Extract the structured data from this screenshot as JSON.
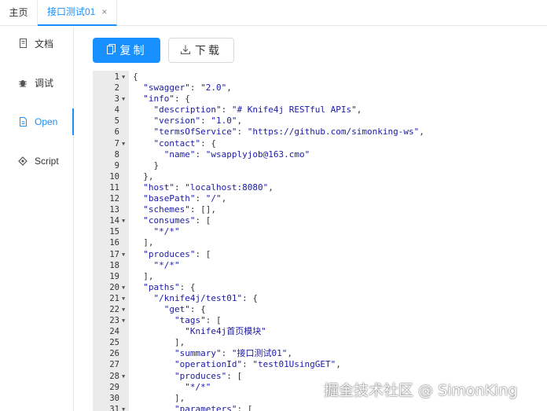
{
  "tabs": [
    {
      "label": "主页",
      "active": false
    },
    {
      "label": "接口测试01",
      "active": true,
      "closable": true
    }
  ],
  "close_icon": "×",
  "menu": [
    {
      "label": "文档",
      "icon": "document-icon",
      "active": false
    },
    {
      "label": "调试",
      "icon": "bug-icon",
      "active": false
    },
    {
      "label": "Open",
      "icon": "file-icon",
      "active": true
    },
    {
      "label": "Script",
      "icon": "code-icon",
      "active": false
    }
  ],
  "buttons": {
    "copy_label": "复制",
    "copy_icon": "copy-icon",
    "download_label": "下载",
    "download_icon": "download-icon"
  },
  "code_lines": [
    {
      "n": "1",
      "fold": true,
      "text": "{"
    },
    {
      "n": "2",
      "fold": false,
      "text": "  \"swagger\": \"2.0\","
    },
    {
      "n": "3",
      "fold": true,
      "text": "  \"info\": {"
    },
    {
      "n": "4",
      "fold": false,
      "text": "    \"description\": \"# Knife4j RESTful APIs\","
    },
    {
      "n": "5",
      "fold": false,
      "text": "    \"version\": \"1.0\","
    },
    {
      "n": "6",
      "fold": false,
      "text": "    \"termsOfService\": \"https://github.com/simonking-ws\","
    },
    {
      "n": "7",
      "fold": true,
      "text": "    \"contact\": {"
    },
    {
      "n": "8",
      "fold": false,
      "text": "      \"name\": \"wsapplyjob@163.cmo\""
    },
    {
      "n": "9",
      "fold": false,
      "text": "    }"
    },
    {
      "n": "10",
      "fold": false,
      "text": "  },"
    },
    {
      "n": "11",
      "fold": false,
      "text": "  \"host\": \"localhost:8080\","
    },
    {
      "n": "12",
      "fold": false,
      "text": "  \"basePath\": \"/\","
    },
    {
      "n": "13",
      "fold": false,
      "text": "  \"schemes\": [],"
    },
    {
      "n": "14",
      "fold": true,
      "text": "  \"consumes\": ["
    },
    {
      "n": "15",
      "fold": false,
      "text": "    \"*/*\""
    },
    {
      "n": "16",
      "fold": false,
      "text": "  ],"
    },
    {
      "n": "17",
      "fold": true,
      "text": "  \"produces\": ["
    },
    {
      "n": "18",
      "fold": false,
      "text": "    \"*/*\""
    },
    {
      "n": "19",
      "fold": false,
      "text": "  ],"
    },
    {
      "n": "20",
      "fold": true,
      "text": "  \"paths\": {"
    },
    {
      "n": "21",
      "fold": true,
      "text": "    \"/knife4j/test01\": {"
    },
    {
      "n": "22",
      "fold": true,
      "text": "      \"get\": {"
    },
    {
      "n": "23",
      "fold": true,
      "text": "        \"tags\": ["
    },
    {
      "n": "24",
      "fold": false,
      "text": "          \"Knife4j首页模块\""
    },
    {
      "n": "25",
      "fold": false,
      "text": "        ],"
    },
    {
      "n": "26",
      "fold": false,
      "text": "        \"summary\": \"接口测试01\","
    },
    {
      "n": "27",
      "fold": false,
      "text": "        \"operationId\": \"test01UsingGET\","
    },
    {
      "n": "28",
      "fold": true,
      "text": "        \"produces\": ["
    },
    {
      "n": "29",
      "fold": false,
      "text": "          \"*/*\""
    },
    {
      "n": "30",
      "fold": false,
      "text": "        ],"
    },
    {
      "n": "31",
      "fold": true,
      "text": "        \"parameters\": ["
    }
  ],
  "watermark": "掘金技术社区 @ SimonKing",
  "colors": {
    "accent": "#1890ff",
    "gutter": "#ebebeb"
  }
}
